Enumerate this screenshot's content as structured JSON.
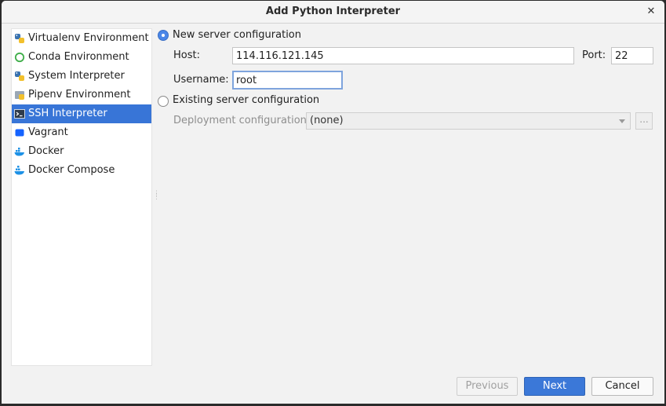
{
  "window": {
    "title": "Add Python Interpreter",
    "close_glyph": "✕"
  },
  "sidebar": {
    "items": [
      {
        "label": "Virtualenv Environment",
        "icon": "python-icon"
      },
      {
        "label": "Conda Environment",
        "icon": "conda-icon"
      },
      {
        "label": "System Interpreter",
        "icon": "python-icon"
      },
      {
        "label": "Pipenv Environment",
        "icon": "pipenv-icon"
      },
      {
        "label": "SSH Interpreter",
        "icon": "terminal-icon",
        "selected": true
      },
      {
        "label": "Vagrant",
        "icon": "vagrant-icon"
      },
      {
        "label": "Docker",
        "icon": "docker-icon"
      },
      {
        "label": "Docker Compose",
        "icon": "docker-compose-icon"
      }
    ]
  },
  "form": {
    "new_server_label": "New server configuration",
    "host_label": "Host:",
    "host_value": "114.116.121.145",
    "port_label": "Port:",
    "port_value": "22",
    "username_label": "Username:",
    "username_value": "root",
    "existing_server_label": "Existing server configuration",
    "deployment_label": "Deployment configuration:",
    "deployment_value": "(none)",
    "browse_glyph": "..."
  },
  "buttons": {
    "previous": "Previous",
    "next": "Next",
    "cancel": "Cancel"
  },
  "colors": {
    "accent": "#3875d7",
    "primary_button": "#3b78d8",
    "background": "#f2f2f2"
  }
}
